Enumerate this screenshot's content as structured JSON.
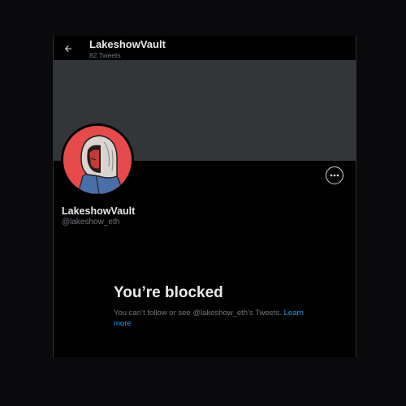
{
  "header": {
    "title": "LakeshowVault",
    "tweet_count": "82 Tweets",
    "back_icon": "arrow-left-icon"
  },
  "profile": {
    "display_name": "LakeshowVault",
    "handle": "@lakeshow_eth",
    "more_icon": "ellipsis-icon",
    "avatar_bg": "#e54b4b"
  },
  "blocked": {
    "title": "You’re blocked",
    "message": "You can’t follow or see @lakeshow_eth’s Tweets.",
    "link_label": "Learn more"
  },
  "colors": {
    "background": "#000000",
    "banner": "#333639",
    "primary_text": "#e7e9ea",
    "secondary_text": "#71767b",
    "link": "#1d9bf0"
  }
}
